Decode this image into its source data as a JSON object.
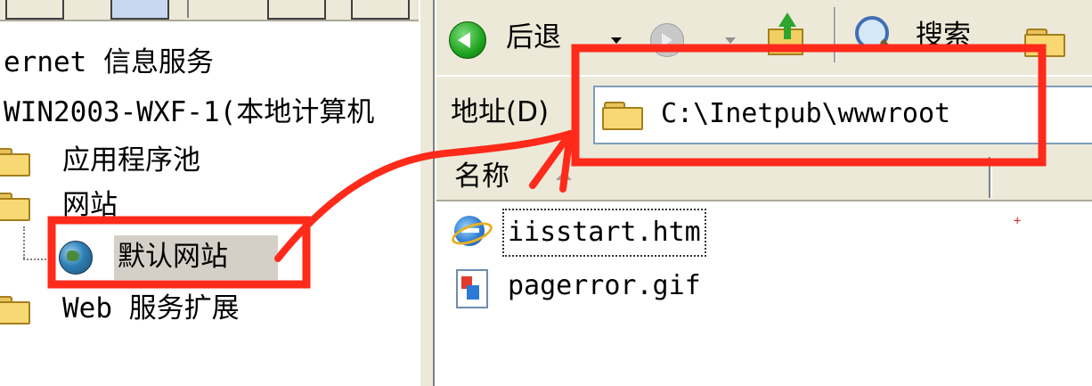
{
  "left_tree": {
    "items": [
      {
        "label": "ernet 信息服务"
      },
      {
        "label": "WIN2003-WXF-1(本地计算机"
      },
      {
        "label": "应用程序池"
      },
      {
        "label": "网站"
      },
      {
        "label": "默认网站",
        "selected": true
      },
      {
        "label": "Web 服务扩展"
      }
    ]
  },
  "toolbar": {
    "back_label": "后退",
    "search_label": "搜索",
    "icons": [
      "back-arrow-icon",
      "forward-arrow-icon",
      "up-folder-icon",
      "search-icon",
      "folders-icon"
    ]
  },
  "address": {
    "label": "地址(D)",
    "value": "C:\\Inetpub\\wwwroot"
  },
  "file_list": {
    "column_header": "名称",
    "files": [
      {
        "name": "iisstart.htm",
        "icon": "ie-document-icon",
        "focused": true
      },
      {
        "name": "pagerror.gif",
        "icon": "gif-image-icon",
        "focused": false
      }
    ]
  },
  "annotation": {
    "color": "#ff2a1a",
    "description_shapes": [
      "highlight-box-site",
      "highlight-box-address",
      "arrow-site-to-address"
    ]
  }
}
